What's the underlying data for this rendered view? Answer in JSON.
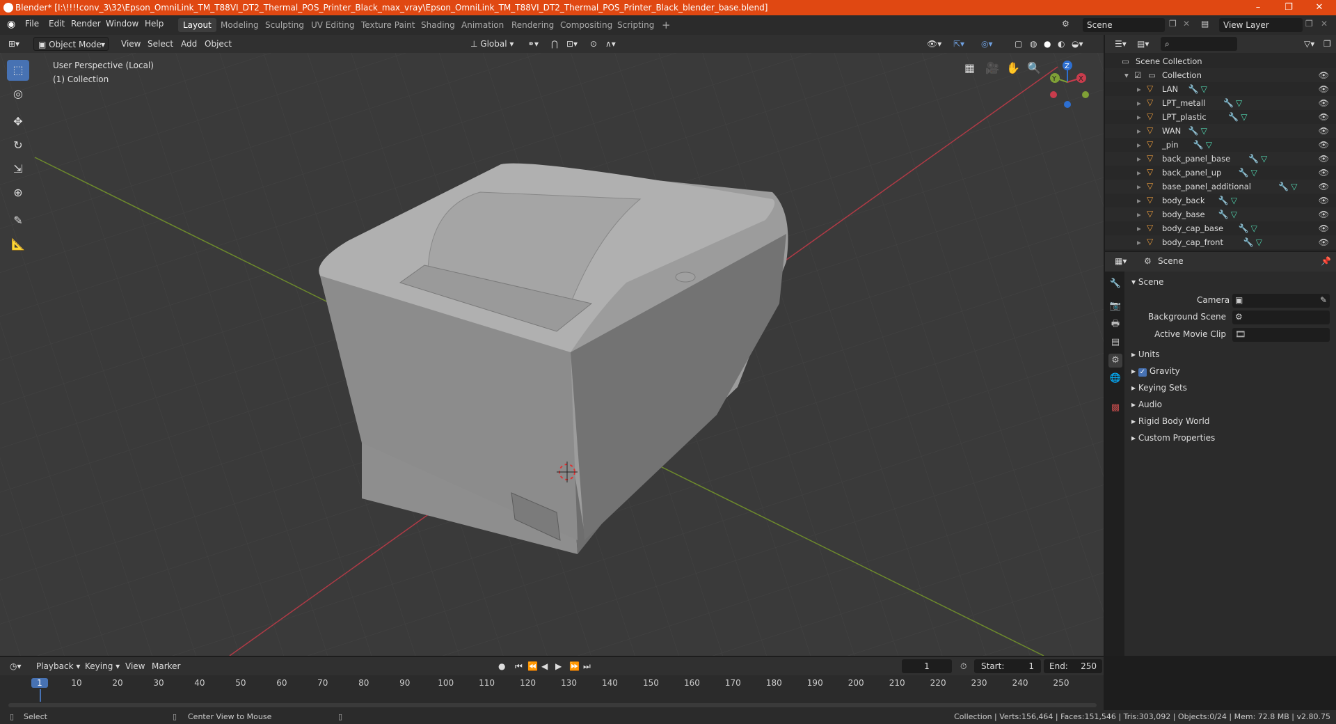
{
  "window": {
    "title": "Blender* [I:\\!!!!conv_3\\32\\Epson_OmniLink_TM_T88VI_DT2_Thermal_POS_Printer_Black_max_vray\\Epson_OmniLink_TM_T88VI_DT2_Thermal_POS_Printer_Black_blender_base.blend]",
    "minimize": "–",
    "maximize": "❐",
    "close": "✕"
  },
  "menubar": {
    "items": [
      "File",
      "Edit",
      "Render",
      "Window",
      "Help"
    ],
    "workspaces": [
      "Layout",
      "Modeling",
      "Sculpting",
      "UV Editing",
      "Texture Paint",
      "Shading",
      "Animation",
      "Rendering",
      "Compositing",
      "Scripting"
    ],
    "active_workspace": "Layout",
    "add_workspace": "+",
    "scene": "Scene",
    "view_layer": "View Layer"
  },
  "viewport_header": {
    "mode": "Object Mode",
    "menus": [
      "View",
      "Select",
      "Add",
      "Object"
    ],
    "transform_orientation": "Global"
  },
  "viewport": {
    "perspective": "User Perspective (Local)",
    "collection": "(1) Collection",
    "gizmo_axes": [
      "X",
      "Y",
      "Z"
    ],
    "colors": {
      "x_axis": "#c83c4c",
      "y_axis": "#7fa036",
      "z_axis": "#2d6fd1",
      "grid_bg": "#3a3a3a",
      "active_tool": "#4772b3"
    }
  },
  "outliner": {
    "search_placeholder": "",
    "scene_collection": "Scene Collection",
    "collection": "Collection",
    "objects": [
      "LAN",
      "LPT_metall",
      "LPT_plastic",
      "WAN",
      "_pin",
      "back_panel_base",
      "back_panel_up",
      "base_panel_additional",
      "body_back",
      "body_base",
      "body_cap_base",
      "body_cap_front"
    ]
  },
  "properties": {
    "header_title": "Scene",
    "panel_title": "Scene",
    "fields": {
      "camera": "Camera",
      "background_scene": "Background Scene",
      "active_movie_clip": "Active Movie Clip"
    },
    "sections": [
      "Units",
      "Gravity",
      "Keying Sets",
      "Audio",
      "Rigid Body World",
      "Custom Properties"
    ],
    "gravity_checked": true
  },
  "timeline": {
    "menus": [
      "Playback",
      "Keying",
      "View",
      "Marker"
    ],
    "current_frame": "1",
    "start_label": "Start:",
    "start": "1",
    "end_label": "End:",
    "end": "250",
    "ticks": [
      "1",
      "10",
      "20",
      "30",
      "40",
      "50",
      "60",
      "70",
      "80",
      "90",
      "100",
      "110",
      "120",
      "130",
      "140",
      "150",
      "160",
      "170",
      "180",
      "190",
      "200",
      "210",
      "220",
      "230",
      "240",
      "250"
    ]
  },
  "statusbar": {
    "left": "Select",
    "middle": "Center View to Mouse",
    "right": "Collection | Verts:156,464 | Faces:151,546 | Tris:303,092 | Objects:0/24 | Mem: 72.8 MB | v2.80.75"
  }
}
